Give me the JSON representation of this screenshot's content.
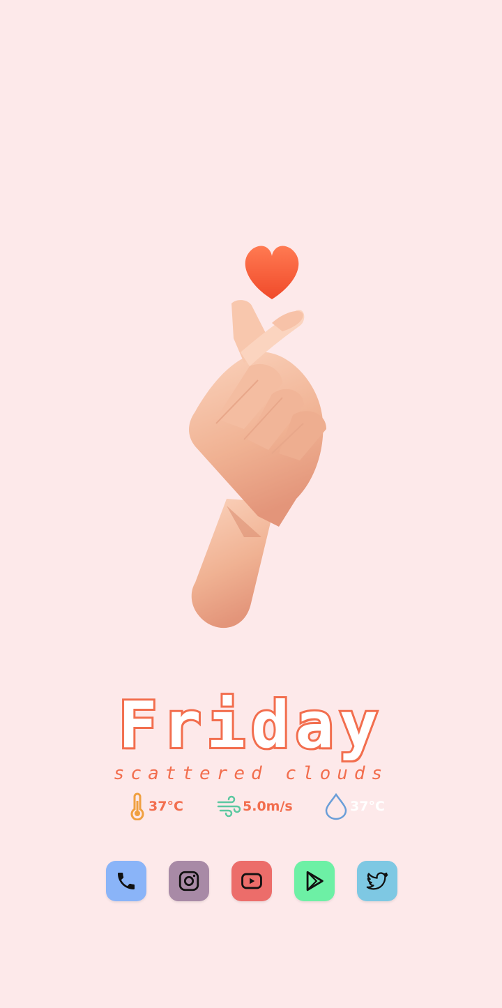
{
  "widget": {
    "day": "Friday",
    "condition": "scattered clouds"
  },
  "weather": {
    "temperature": "37°C",
    "wind_speed": "5.0m/s",
    "humidity": "37°C"
  },
  "dock": {
    "apps": [
      {
        "name": "Phone",
        "icon": "phone-icon",
        "color": "#8ab4f8"
      },
      {
        "name": "Instagram",
        "icon": "instagram-icon",
        "color": "#a88aa6"
      },
      {
        "name": "YouTube",
        "icon": "youtube-icon",
        "color": "#ec6d6a"
      },
      {
        "name": "Play Store",
        "icon": "play-store-icon",
        "color": "#6df0a5"
      },
      {
        "name": "Twitter",
        "icon": "twitter-icon",
        "color": "#7ec8e3"
      }
    ]
  },
  "colors": {
    "background": "#fde9ea",
    "accent": "#f26e4e",
    "temperature": "#f0a040",
    "wind": "#5cc8a0",
    "humidity": "#6a9ed8",
    "heart": "#ff5a35",
    "skin": "#f2b89a"
  }
}
